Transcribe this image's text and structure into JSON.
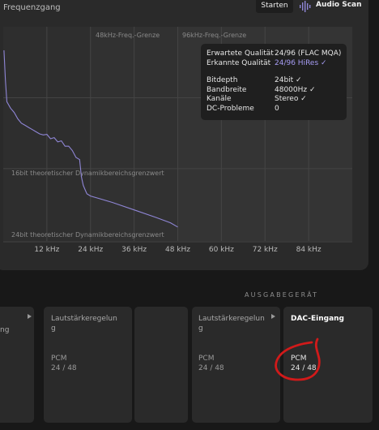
{
  "header": {
    "title": "Frequenzgang",
    "start_label": "Starten",
    "scan_label": "Audio Scan"
  },
  "chart_data": {
    "type": "line",
    "title": "Frequenzgang",
    "x_unit": "kHz",
    "xlim": [
      0,
      96
    ],
    "x_ticks": [
      12,
      24,
      36,
      48,
      60,
      72,
      84
    ],
    "x_tick_labels": [
      "12 kHz",
      "24 kHz",
      "36 kHz",
      "48 kHz",
      "60 kHz",
      "72 kHz",
      "84 kHz"
    ],
    "grid": true,
    "region_labels": [
      "48kHz-Freq.-Grenze",
      "96kHz-Freq.-Grenze"
    ],
    "reference_lines": [
      "16bit theoretischer Dynamikbereichsgrenzwert",
      "24bit theoretischer Dynamikbereichsgrenzwert"
    ],
    "series": [
      {
        "color": "#8f86d6",
        "x": [
          0.2,
          0.6,
          1,
          2,
          3,
          4,
          5,
          6,
          7,
          8,
          9,
          10,
          11,
          12,
          13,
          14,
          15,
          16,
          17,
          18,
          19,
          20,
          21,
          21.5,
          22,
          22.5,
          23,
          24,
          30,
          36,
          42,
          46,
          48
        ],
        "y": [
          0.11,
          0.25,
          0.35,
          0.38,
          0.4,
          0.43,
          0.45,
          0.46,
          0.47,
          0.48,
          0.49,
          0.5,
          0.505,
          0.51,
          0.515,
          0.525,
          0.53,
          0.54,
          0.55,
          0.565,
          0.57,
          0.61,
          0.62,
          0.7,
          0.74,
          0.76,
          0.78,
          0.79,
          0.82,
          0.855,
          0.89,
          0.915,
          0.935
        ]
      }
    ]
  },
  "tooltip": {
    "rows": [
      {
        "label": "Erwartete Qualität",
        "value": "24/96 (FLAC MQA)"
      },
      {
        "label": "Erkannte Qualität",
        "value": "24/96 HiRes ✓"
      },
      {
        "label": "Bitdepth",
        "value": "24bit ✓"
      },
      {
        "label": "Bandbreite",
        "value": "48000Hz ✓"
      },
      {
        "label": "Kanäle",
        "value": "Stereo ✓"
      },
      {
        "label": "DC-Probleme",
        "value": "0"
      }
    ]
  },
  "output": {
    "section_label": "AUSGABEGERÄT",
    "cards": [
      {
        "title": "ng",
        "sub": ""
      },
      {
        "title": "Lautstärkeregelun g",
        "sub": "PCM 24 / 48"
      },
      {
        "title": "",
        "sub": ""
      },
      {
        "title": "Lautstärkeregelun g",
        "sub": "PCM 24 / 48"
      },
      {
        "title": "DAC-Eingang",
        "sub": "PCM 24 / 48"
      }
    ],
    "cards_text": {
      "c0_title": "ng",
      "c1_title_a": "Lautstärkeregelun",
      "c1_title_b": "g",
      "c1_sub_a": "PCM",
      "c1_sub_b": "24 / 48",
      "c3_title_a": "Lautstärkeregelun",
      "c3_title_b": "g",
      "c3_sub_a": "PCM",
      "c3_sub_b": "24 / 48",
      "c4_title": "DAC-Eingang",
      "c4_sub_a": "PCM",
      "c4_sub_b": "24 / 48"
    }
  },
  "colors": {
    "accent": "#8f86d6",
    "annotation_red": "#d11a1a"
  }
}
